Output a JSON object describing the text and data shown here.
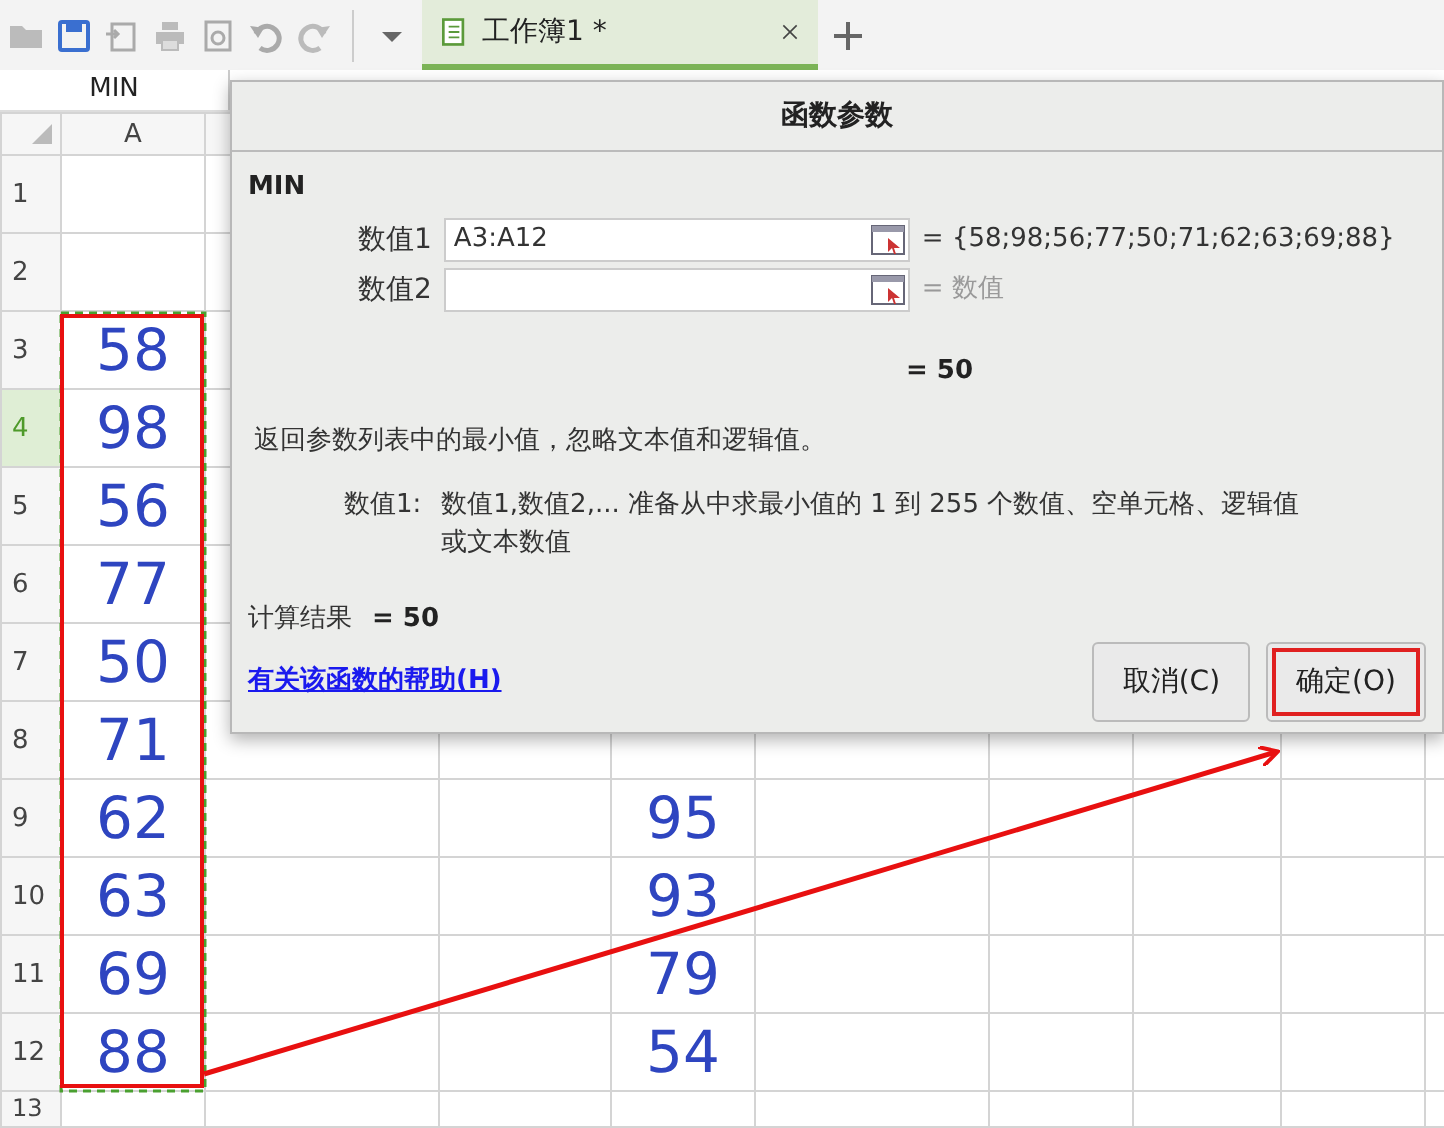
{
  "tabs": [
    {
      "label": "工作簿1 *",
      "selected": true
    }
  ],
  "name_box": "MIN",
  "columns": [
    "A"
  ],
  "rows": [
    {
      "header": "1",
      "selected": false
    },
    {
      "header": "2",
      "selected": false
    },
    {
      "header": "3",
      "selected": false,
      "column_a": "58"
    },
    {
      "header": "4",
      "selected": true,
      "column_a": "98"
    },
    {
      "header": "5",
      "selected": false,
      "column_a": "56"
    },
    {
      "header": "6",
      "selected": false,
      "column_a": "77"
    },
    {
      "header": "7",
      "selected": false,
      "column_a": "50"
    },
    {
      "header": "8",
      "selected": false,
      "column_a": "71"
    },
    {
      "header": "9",
      "selected": false,
      "column_a": "62",
      "column_d": "95"
    },
    {
      "header": "10",
      "selected": false,
      "column_a": "63",
      "column_d": "93"
    },
    {
      "header": "11",
      "selected": false,
      "column_a": "69",
      "column_d": "79"
    },
    {
      "header": "12",
      "selected": false,
      "column_a": "88",
      "column_d": "54"
    },
    {
      "header": "13",
      "selected": false
    }
  ],
  "dialog": {
    "title": "函数参数",
    "function_name": "MIN",
    "arguments": [
      {
        "label": "数值1",
        "value": "A3:A12",
        "result": "= {58;98;56;77;50;71;62;63;69;88}",
        "greyed": false
      },
      {
        "label": "数值2",
        "result": "= 数值",
        "greyed": true
      }
    ],
    "formula_result": "= 50",
    "description": "返回参数列表中的最小值，忽略文本值和逻辑值。",
    "argument_help": {
      "label": "数值1:",
      "text": "数值1,数值2,... 准备从中求最小值的 1 到 255 个数值、空单元格、逻辑值或文本数值"
    },
    "result_label": "计算结果",
    "result_value": "= 50",
    "help_link": "有关该函数的帮助(H)",
    "buttons": [
      {
        "label": "取消(C)",
        "highlighted": false
      },
      {
        "label": "确定(O)",
        "highlighted": true
      }
    ]
  }
}
